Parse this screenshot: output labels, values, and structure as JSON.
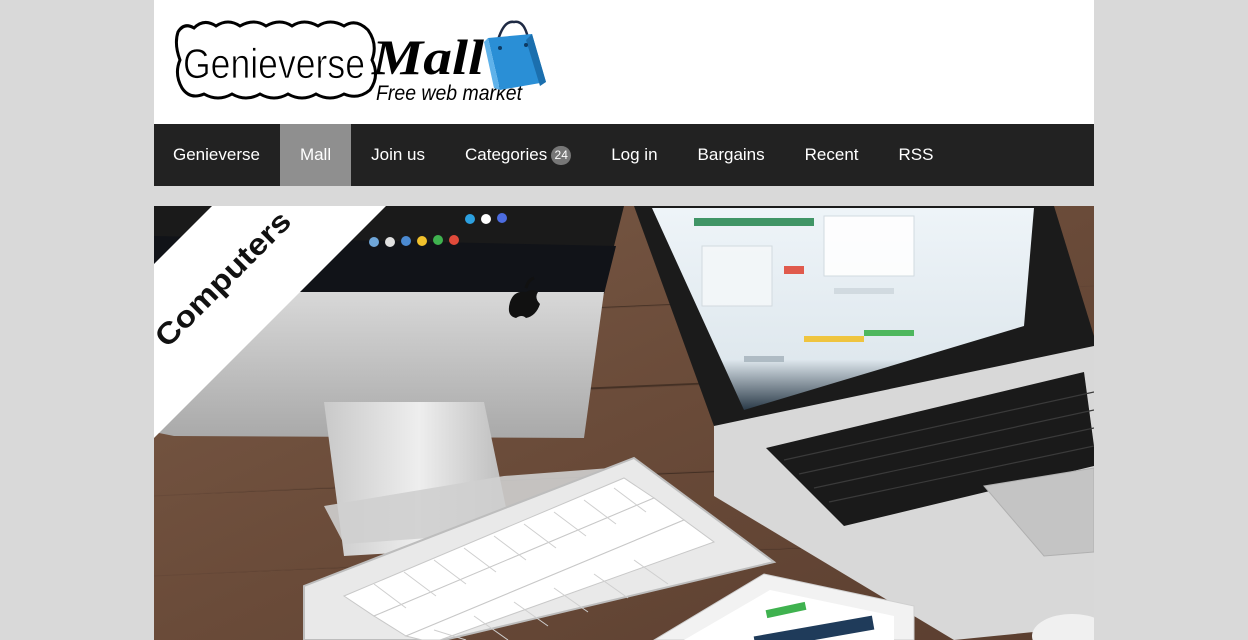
{
  "logo": {
    "word1": "Genieverse",
    "word2": "Mall",
    "tagline": "Free web market"
  },
  "nav": {
    "items": [
      {
        "label": "Genieverse"
      },
      {
        "label": "Mall",
        "active": true
      },
      {
        "label": "Join us"
      },
      {
        "label": "Categories",
        "badge": "24"
      },
      {
        "label": "Log in"
      },
      {
        "label": "Bargains"
      },
      {
        "label": "Recent"
      },
      {
        "label": "RSS"
      }
    ]
  },
  "banner": {
    "ribbon_label": "Computers"
  },
  "colors": {
    "page_background": "#d9d9d9",
    "nav_background": "#222222",
    "nav_active": "#8f8f8f",
    "badge": "#777777",
    "bag_blue": "#2a8fd6"
  }
}
